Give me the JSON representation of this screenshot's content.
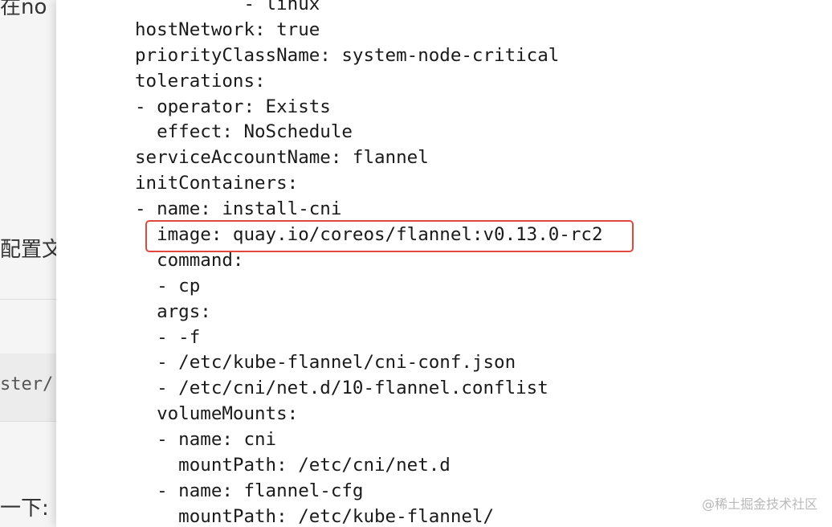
{
  "background_article": {
    "fragments": [
      "在no",
      "配置文",
      "ster/",
      "一下:"
    ]
  },
  "code_view": {
    "lines": [
      "          - linux",
      "hostNetwork: true",
      "priorityClassName: system-node-critical",
      "tolerations:",
      "- operator: Exists",
      "  effect: NoSchedule",
      "serviceAccountName: flannel",
      "initContainers:",
      "- name: install-cni",
      "  image: quay.io/coreos/flannel:v0.13.0-rc2",
      "  command:",
      "  - cp",
      "  args:",
      "  - -f",
      "  - /etc/kube-flannel/cni-conf.json",
      "  - /etc/cni/net.d/10-flannel.conflist",
      "  volumeMounts:",
      "  - name: cni",
      "    mountPath: /etc/cni/net.d",
      "  - name: flannel-cfg",
      "    mountPath: /etc/kube-flannel/"
    ],
    "highlight_color": "#e0483e"
  },
  "watermark": {
    "text": "@稀土掘金技术社区"
  }
}
